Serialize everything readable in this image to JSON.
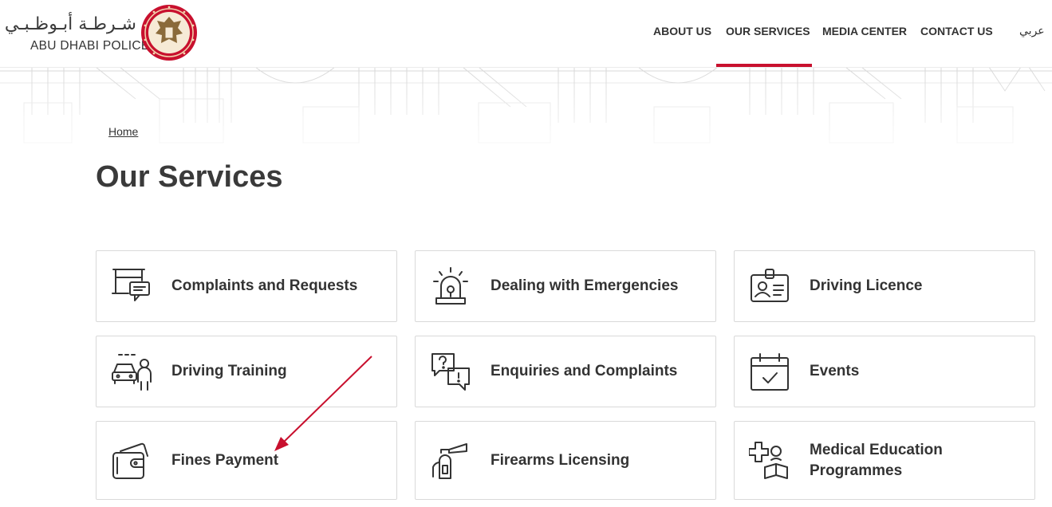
{
  "header": {
    "logo_arabic": "شـرطـة أبـوظـبـي",
    "logo_english": "ABU DHABI POLICE",
    "nav": [
      {
        "label": "ABOUT US",
        "active": false
      },
      {
        "label": "OUR SERVICES",
        "active": true
      },
      {
        "label": "MEDIA CENTER",
        "active": false
      },
      {
        "label": "CONTACT US",
        "active": false
      }
    ],
    "language_toggle": "عربي",
    "accent_color": "#c8102e"
  },
  "breadcrumb": {
    "home": "Home"
  },
  "page": {
    "title": "Our Services"
  },
  "services": [
    {
      "label": "Complaints and Requests",
      "icon": "complaints-board-icon"
    },
    {
      "label": "Dealing with Emergencies",
      "icon": "siren-icon"
    },
    {
      "label": "Driving Licence",
      "icon": "id-card-icon"
    },
    {
      "label": "Driving Training",
      "icon": "car-instructor-icon"
    },
    {
      "label": "Enquiries and Complaints",
      "icon": "question-chat-icon"
    },
    {
      "label": "Events",
      "icon": "calendar-icon"
    },
    {
      "label": "Fines Payment",
      "icon": "wallet-icon"
    },
    {
      "label": "Firearms Licensing",
      "icon": "fire-extinguisher-icon"
    },
    {
      "label": "Medical Education Programmes",
      "icon": "medical-book-icon"
    }
  ],
  "annotation": {
    "arrow_color": "#c8102e"
  }
}
